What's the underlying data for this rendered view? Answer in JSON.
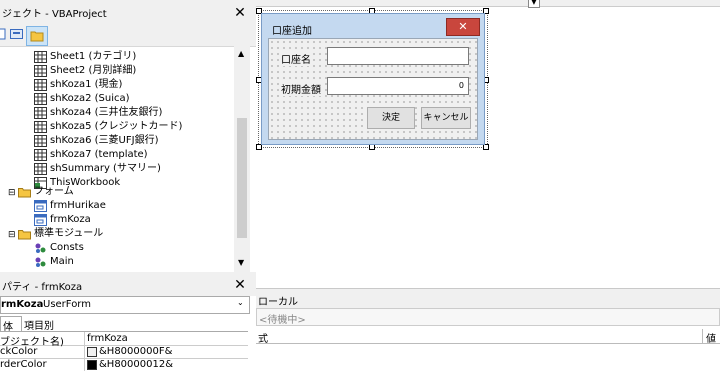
{
  "project": {
    "title": "ジェクト - VBAProject",
    "tree": [
      {
        "label": "Sheet1 (カテゴリ)",
        "icon": "sheet-icon"
      },
      {
        "label": "Sheet2 (月別詳細)",
        "icon": "sheet-icon"
      },
      {
        "label": "shKoza1 (現金)",
        "icon": "sheet-icon"
      },
      {
        "label": "shKoza2 (Suica)",
        "icon": "sheet-icon"
      },
      {
        "label": "shKoza4 (三井住友銀行)",
        "icon": "sheet-icon"
      },
      {
        "label": "shKoza5 (クレジットカード)",
        "icon": "sheet-icon"
      },
      {
        "label": "shKoza6 (三菱UFJ銀行)",
        "icon": "sheet-icon"
      },
      {
        "label": "shKoza7 (template)",
        "icon": "sheet-icon"
      },
      {
        "label": "shSummary (サマリー)",
        "icon": "sheet-icon"
      },
      {
        "label": "ThisWorkbook",
        "icon": "workbook-icon"
      },
      {
        "label": "フォーム",
        "icon": "folder-icon"
      },
      {
        "label": "frmHurikae",
        "icon": "form-icon"
      },
      {
        "label": "frmKoza",
        "icon": "form-icon"
      },
      {
        "label": "標準モジュール",
        "icon": "folder-icon"
      },
      {
        "label": "Consts",
        "icon": "module-icon"
      },
      {
        "label": "Main",
        "icon": "module-icon"
      }
    ]
  },
  "properties": {
    "title": "パティ - frmKoza",
    "object_name": "rmKoza",
    "object_type": "UserForm",
    "tabs": [
      "体",
      "項目別"
    ],
    "rows": [
      {
        "name": "ブジェクト名)",
        "value": "frmKoza",
        "swatch": ""
      },
      {
        "name": "ckColor",
        "value": "&H8000000F&",
        "swatch": "#f0f0f0"
      },
      {
        "name": "rderColor",
        "value": "&H80000012&",
        "swatch": "#000000"
      }
    ]
  },
  "form": {
    "title": "口座追加",
    "label_name": "口座名",
    "label_amount": "初期金額",
    "amount_value": "0",
    "ok_label": "決定",
    "cancel_label": "キャンセル"
  },
  "locals": {
    "title": "ローカル",
    "status": "<待機中>",
    "col_expr": "式",
    "col_value": "値"
  },
  "icons": {
    "close": "close-icon"
  }
}
